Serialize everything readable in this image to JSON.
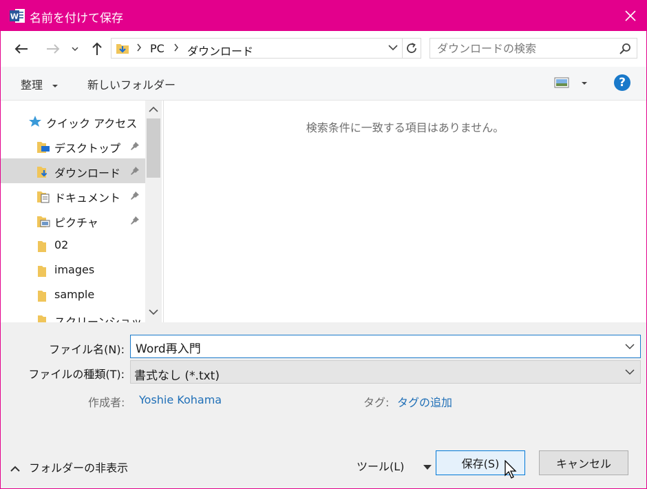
{
  "window": {
    "title": "名前を付けて保存",
    "accent": "#e3008c",
    "app_icon": "word-icon"
  },
  "nav": {
    "breadcrumbs": [
      "PC",
      "ダウンロード"
    ],
    "search_placeholder": "ダウンロードの検索"
  },
  "toolbar": {
    "organize": "整理",
    "new_folder": "新しいフォルダー",
    "help": "?"
  },
  "sidebar": {
    "quick_access": "クイック アクセス",
    "items": [
      {
        "label": "デスクトップ",
        "pinned": true,
        "icon": "desktop-folder-icon"
      },
      {
        "label": "ダウンロード",
        "pinned": true,
        "selected": true,
        "icon": "download-folder-icon"
      },
      {
        "label": "ドキュメント",
        "pinned": true,
        "icon": "documents-folder-icon"
      },
      {
        "label": "ピクチャ",
        "pinned": true,
        "icon": "pictures-folder-icon"
      },
      {
        "label": "02",
        "icon": "folder-icon"
      },
      {
        "label": "images",
        "icon": "folder-icon"
      },
      {
        "label": "sample",
        "icon": "folder-icon"
      },
      {
        "label": "スクリーンショット",
        "icon": "folder-icon"
      }
    ]
  },
  "content": {
    "empty_message": "検索条件に一致する項目はありません。"
  },
  "form": {
    "filename_label": "ファイル名(N):",
    "filename_value": "Word再入門",
    "filetype_label": "ファイルの種類(T):",
    "filetype_value": "書式なし (*.txt)",
    "author_label": "作成者:",
    "author_value": "Yoshie Kohama",
    "tags_label": "タグ:",
    "tags_value": "タグの追加"
  },
  "footer": {
    "hide_folders": "フォルダーの非表示",
    "tools": "ツール(L)",
    "save": "保存(S)",
    "cancel": "キャンセル"
  }
}
